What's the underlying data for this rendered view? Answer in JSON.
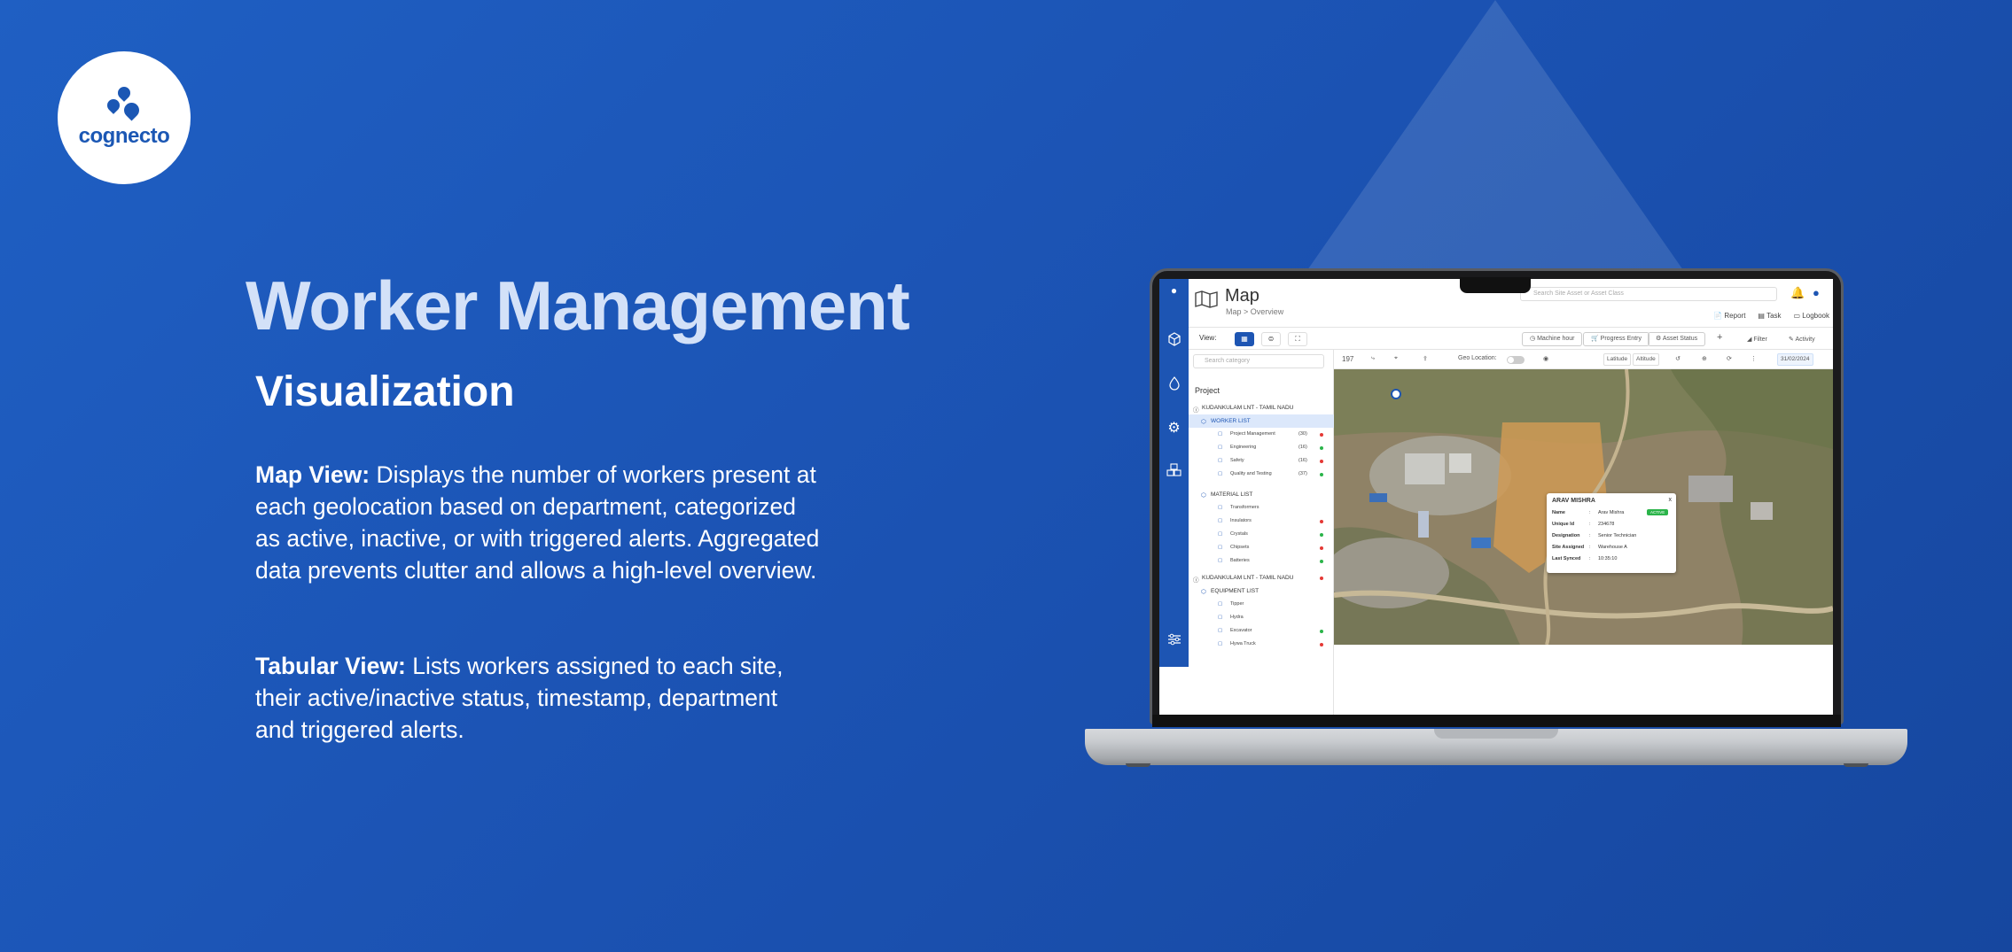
{
  "brand": {
    "logo_text": "cognecto"
  },
  "hero": {
    "title": "Worker Management",
    "subtitle": "Visualization",
    "map_view_label": "Map View:",
    "map_view_text": "Displays the number of workers present at each geolocation based on department, categorized as active, inactive, or with triggered alerts. Aggregated data prevents clutter and allows a high-level overview.",
    "tabular_view_label": "Tabular View:",
    "tabular_view_text": "Lists workers assigned to each site, their active/inactive status, timestamp, department and triggered alerts."
  },
  "colors": {
    "background": "#1b52b2",
    "accent": "#1d55b3",
    "active": "#2bb44a",
    "alert": "#e53935"
  },
  "app": {
    "page_title": "Map",
    "breadcrumb": "Map > Overview",
    "search_placeholder": "Search Site Asset or Asset Class",
    "header_actions": [
      "Report",
      "Task",
      "Logbook"
    ],
    "view_label": "View:",
    "top_buttons": [
      "Machine hour",
      "Progress Entry",
      "Asset Status"
    ],
    "filter_label": "Filter",
    "activity_label": "Activity",
    "category_search_placeholder": "Search category",
    "project_label": "Project",
    "toolbar": {
      "count": "197",
      "geo_location_label": "Geo Location:",
      "latitude_label": "Latitude",
      "altitude_label": "Altitude",
      "date": "31/02/2024"
    },
    "tree": {
      "site_1": "KUDANKULAM LNT - TAMIL NADU",
      "worker_list": "WORKER LIST",
      "workers": [
        {
          "name": "Project Management",
          "count": "(30)"
        },
        {
          "name": "Engineering",
          "count": "(16)"
        },
        {
          "name": "Safety",
          "count": "(16)"
        },
        {
          "name": "Quality and Testing",
          "count": "(37)"
        }
      ],
      "material_list": "MATERIAL LIST",
      "materials": [
        "Transformers",
        "Insulators",
        "Crystals",
        "Chipsets",
        "Batteries"
      ],
      "site_2": "KUDANKULAM LNT - TAMIL NADU",
      "equipment_list": "EQUIPMENT LIST",
      "equipment": [
        "Tipper",
        "Hydra",
        "Excavator",
        "Hywa Truck"
      ]
    },
    "popup": {
      "title": "ARAV MISHRA",
      "close": "x",
      "badge": "ACTIVE",
      "name_key": "Name",
      "name_val": "Arav Mishra",
      "id_key": "Unique Id",
      "id_val": "234678",
      "designation_key": "Designation",
      "designation_val": "Senior Technician",
      "site_key": "Site Assigned",
      "site_val": "Warehouse A",
      "synced_key": "Last Synced",
      "synced_val": "10:35:10"
    }
  }
}
